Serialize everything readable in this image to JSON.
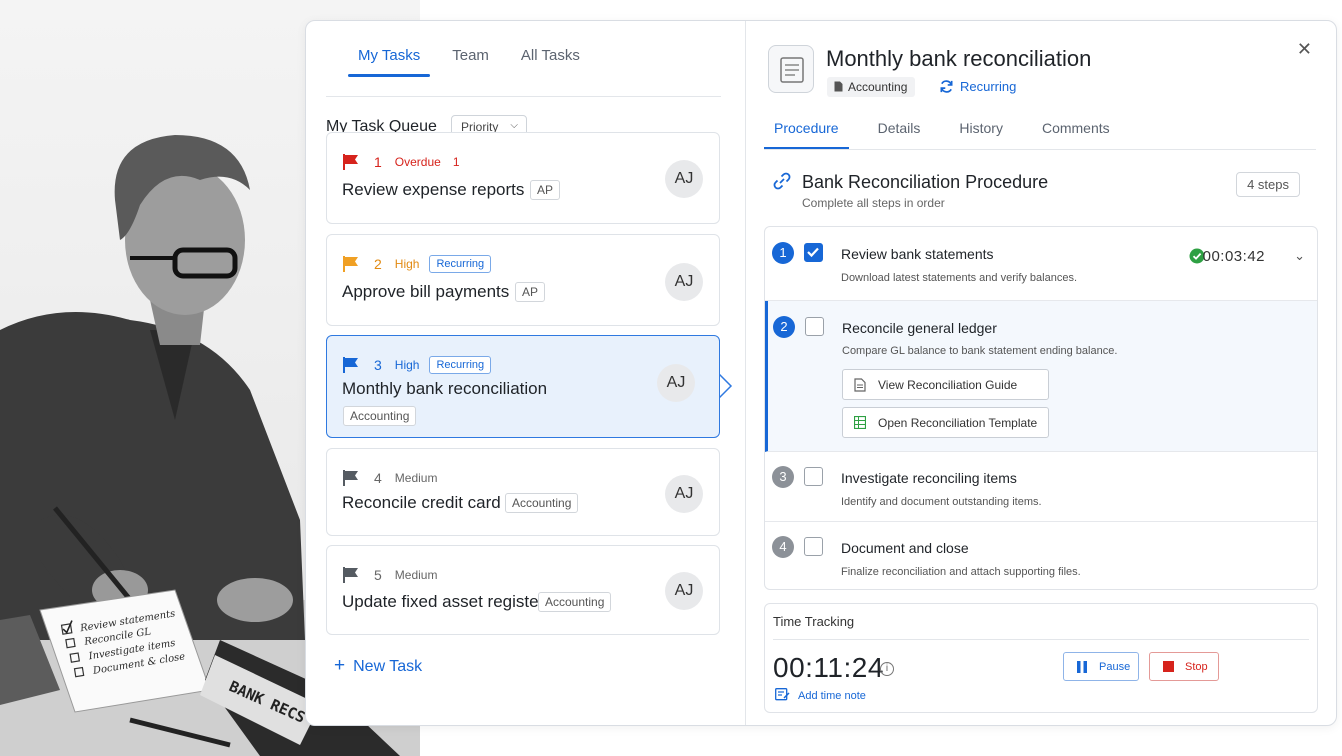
{
  "photo": {
    "notepad_lines": [
      "Review statements",
      "Reconcile GL",
      "Investigate items",
      "Document & close"
    ],
    "binder_label": "BANK RECS"
  },
  "tasks_pane": {
    "tabs": [
      {
        "label": "My Tasks",
        "active": true
      },
      {
        "label": "Team",
        "active": false
      },
      {
        "label": "All Tasks",
        "active": false
      }
    ],
    "queue_title": "My Task Queue",
    "sort_label": "Priority",
    "tasks": [
      {
        "number": "1",
        "priority": "Overdue",
        "overdue_count": "1",
        "title": "Review expense reports",
        "tag": "AP",
        "avatar": "AJ",
        "flag_color": "#d6231c",
        "priority_color": "#d6231c"
      },
      {
        "number": "2",
        "priority": "High",
        "badge": "Recurring",
        "title": "Approve bill payments",
        "tag": "AP",
        "avatar": "AJ",
        "flag_color": "#f0a024",
        "priority_color": "#e28a12"
      },
      {
        "number": "3",
        "priority": "High",
        "badge": "Recurring",
        "title": "Monthly bank reconciliation",
        "tag": "Accounting",
        "avatar": "AJ",
        "flag_color": "#1767d6",
        "priority_color": "#1767d6",
        "selected": true
      },
      {
        "number": "4",
        "priority": "Medium",
        "title": "Reconcile credit card",
        "tag": "Accounting",
        "avatar": "AJ",
        "flag_color": "#555b62",
        "priority_color": "#666"
      },
      {
        "number": "5",
        "priority": "Medium",
        "title": "Update fixed asset register",
        "tag": "Accounting",
        "avatar": "AJ",
        "flag_color": "#555b62",
        "priority_color": "#666"
      }
    ],
    "new_task_label": "New Task"
  },
  "detail": {
    "title": "Monthly bank reconciliation",
    "category": "Accounting",
    "recurring_label": "Recurring",
    "tabs": [
      {
        "label": "Procedure",
        "active": true
      },
      {
        "label": "Details",
        "active": false
      },
      {
        "label": "History",
        "active": false
      },
      {
        "label": "Comments",
        "active": false
      }
    ],
    "procedure": {
      "title": "Bank Reconciliation Procedure",
      "subtitle": "Complete all steps in order",
      "steps_count": "4 steps",
      "steps": [
        {
          "number": "1",
          "title": "Review bank statements",
          "description": "Download latest statements and verify balances.",
          "checked": true,
          "timer": "00:03:42"
        },
        {
          "number": "2",
          "title": "Reconcile general ledger",
          "description": "Compare GL balance to bank statement ending balance.",
          "checked": false,
          "resources": [
            "View Reconciliation Guide",
            "Open Reconciliation Template"
          ]
        },
        {
          "number": "3",
          "title": "Investigate reconciling items",
          "description": "Identify and document outstanding items.",
          "checked": false
        },
        {
          "number": "4",
          "title": "Document and close",
          "description": "Finalize reconciliation and attach supporting files.",
          "checked": false
        }
      ]
    },
    "time_tracking": {
      "label": "Time Tracking",
      "elapsed": "00:11:24",
      "pause_label": "Pause",
      "stop_label": "Stop",
      "add_note_label": "Add time note"
    }
  },
  "colors": {
    "accent": "#1767d6",
    "overdue": "#d6231c",
    "high": "#e28a12",
    "success": "#2ea043"
  }
}
